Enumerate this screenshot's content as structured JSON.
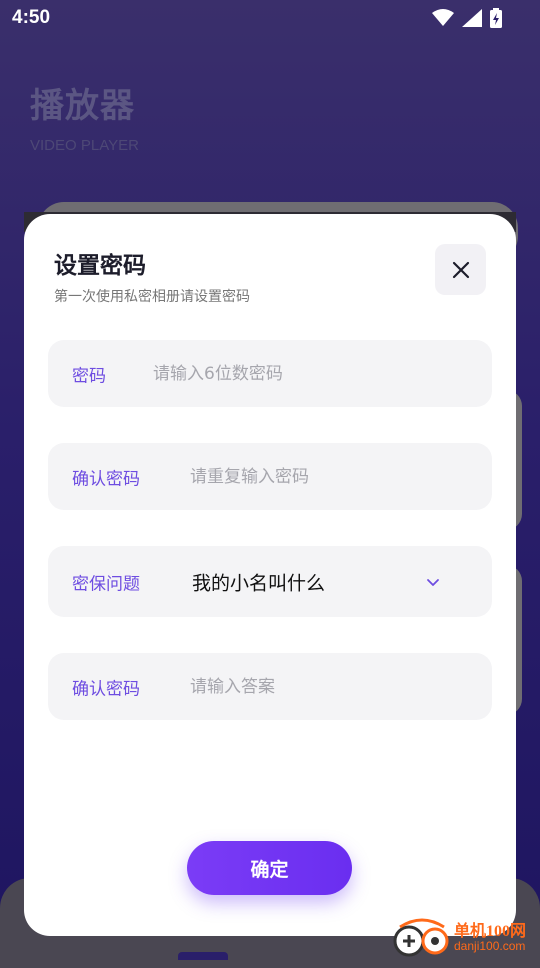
{
  "status_bar": {
    "time": "4:50"
  },
  "background": {
    "title": "播放器",
    "subtitle": "VIDEO PLAYER"
  },
  "dialog": {
    "title": "设置密码",
    "subtitle": "第一次使用私密相册请设置密码",
    "fields": [
      {
        "label": "密码",
        "placeholder": "请输入6位数密码",
        "value": ""
      },
      {
        "label": "确认密码",
        "placeholder": "请重复输入密码",
        "value": ""
      },
      {
        "label": "密保问题",
        "selected": "我的小名叫什么"
      },
      {
        "label": "确认密码",
        "placeholder": "请输入答案",
        "value": ""
      }
    ],
    "confirm_label": "确定"
  },
  "watermark": {
    "name": "单机100网",
    "url": "danji100.com"
  },
  "colors": {
    "accent": "#6e4de1",
    "button": "#7b3cf6",
    "background": "#2a1f6a"
  },
  "icons": [
    "wifi-icon",
    "signal-icon",
    "battery-icon",
    "close-icon",
    "chevron-down-icon"
  ]
}
